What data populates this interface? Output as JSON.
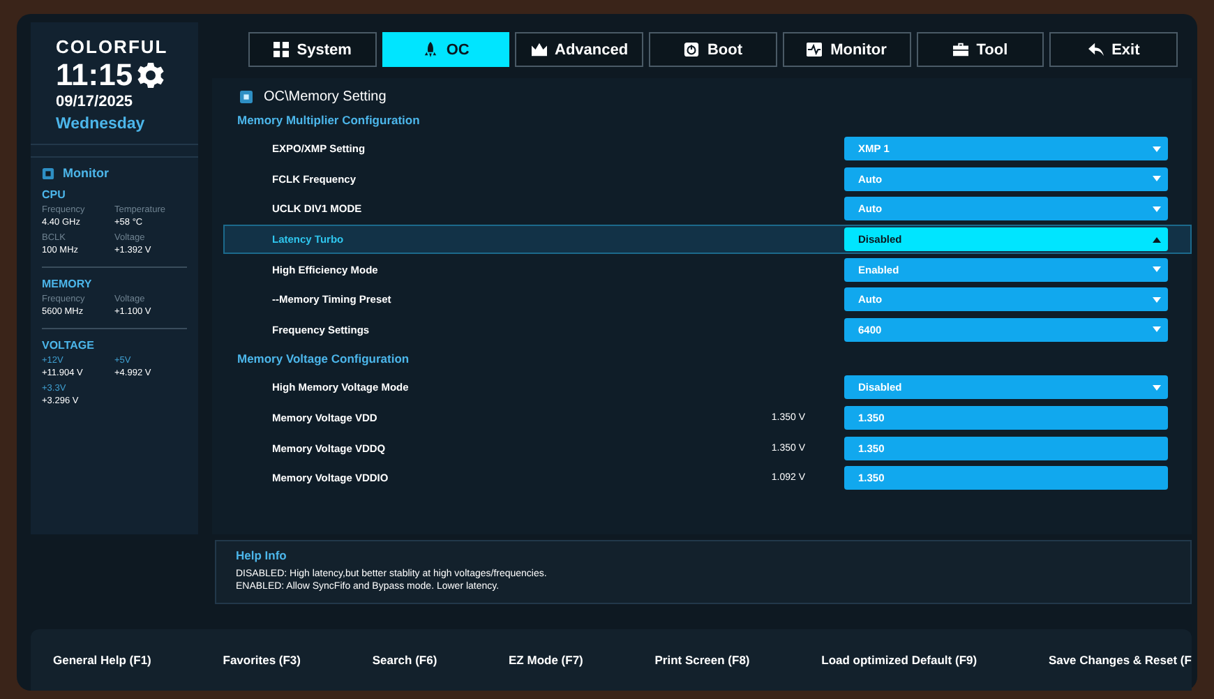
{
  "brand": {
    "logo": "COLORFUL",
    "time": "11:15",
    "date": "09/17/2025",
    "weekday": "Wednesday"
  },
  "monitor": {
    "title": "Monitor",
    "groups": [
      {
        "title": "CPU",
        "items": [
          {
            "label": "Frequency",
            "value": "4.40 GHz"
          },
          {
            "label": "Temperature",
            "value": "+58 °C"
          },
          {
            "label": "BCLK",
            "value": "100 MHz"
          },
          {
            "label": "Voltage",
            "value": "+1.392 V"
          }
        ]
      },
      {
        "title": "MEMORY",
        "items": [
          {
            "label": "Frequency",
            "value": "5600 MHz"
          },
          {
            "label": "Voltage",
            "value": "+1.100 V"
          }
        ]
      },
      {
        "title": "VOLTAGE",
        "items": [
          {
            "label": "+12V",
            "value": "+11.904 V"
          },
          {
            "label": "+5V",
            "value": "+4.992 V"
          },
          {
            "label": "+3.3V",
            "value": "+3.296 V"
          }
        ]
      }
    ]
  },
  "tabs": [
    {
      "label": "System",
      "selected": false
    },
    {
      "label": "OC",
      "selected": true
    },
    {
      "label": "Advanced",
      "selected": false
    },
    {
      "label": "Boot",
      "selected": false
    },
    {
      "label": "Monitor",
      "selected": false
    },
    {
      "label": "Tool",
      "selected": false
    },
    {
      "label": "Exit",
      "selected": false
    }
  ],
  "breadcrumb": "OC\\Memory Setting",
  "sections": [
    {
      "title": "Memory Multiplier Configuration",
      "rows": [
        {
          "kind": "dropdown",
          "label": "EXPO/XMP Setting",
          "value": "XMP 1",
          "selected": false
        },
        {
          "kind": "dropdown",
          "label": "FCLK Frequency",
          "value": "Auto",
          "selected": false
        },
        {
          "kind": "dropdown",
          "label": "UCLK DIV1 MODE",
          "value": "Auto",
          "selected": false
        },
        {
          "kind": "dropdown",
          "label": "Latency Turbo",
          "value": "Disabled",
          "selected": true
        },
        {
          "kind": "dropdown",
          "label": "High Efficiency Mode",
          "value": "Enabled",
          "selected": false
        },
        {
          "kind": "dropdown",
          "label": "--Memory Timing Preset",
          "value": "Auto",
          "selected": false
        },
        {
          "kind": "dropdown",
          "label": "Frequency Settings",
          "value": "6400",
          "selected": false
        }
      ]
    },
    {
      "title": "Memory Voltage Configuration",
      "rows": [
        {
          "kind": "dropdown",
          "label": "High Memory Voltage Mode",
          "value": "Disabled",
          "selected": false
        },
        {
          "kind": "voltage",
          "label": "Memory Voltage VDD",
          "reading": "1.350 V",
          "value": "1.350",
          "selected": false
        },
        {
          "kind": "voltage",
          "label": "Memory Voltage VDDQ",
          "reading": "1.350 V",
          "value": "1.350",
          "selected": false
        },
        {
          "kind": "voltage",
          "label": "Memory Voltage VDDIO",
          "reading": "1.092 V",
          "value": "1.350",
          "selected": false
        }
      ]
    }
  ],
  "help": {
    "title": "Help Info",
    "lines": [
      "DISABLED: High latency,but better stablity at high voltages/frequencies.",
      "ENABLED: Allow SyncFifo and Bypass mode. Lower latency."
    ]
  },
  "footer": [
    "General Help (F1)",
    "Favorites (F3)",
    "Search (F6)",
    "EZ Mode (F7)",
    "Print Screen (F8)",
    "Load optimized Default (F9)",
    "Save Changes & Reset (F"
  ]
}
